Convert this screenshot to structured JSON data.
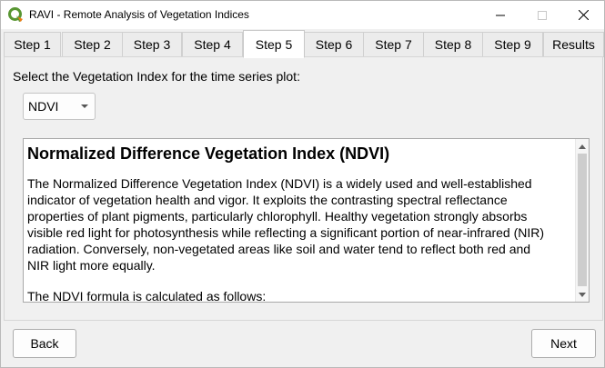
{
  "window": {
    "title": "RAVI - Remote Analysis of Vegetation Indices",
    "icon": "qgis-logo-icon",
    "controls": [
      "minimize-icon",
      "maximize-icon",
      "close-icon"
    ]
  },
  "tabs": [
    {
      "label": "Step 1",
      "active": false
    },
    {
      "label": "Step 2",
      "active": false
    },
    {
      "label": "Step 3",
      "active": false
    },
    {
      "label": "Step 4",
      "active": false
    },
    {
      "label": "Step 5",
      "active": true
    },
    {
      "label": "Step 6",
      "active": false
    },
    {
      "label": "Step 7",
      "active": false
    },
    {
      "label": "Step 8",
      "active": false
    },
    {
      "label": "Step 9",
      "active": false
    },
    {
      "label": "Results",
      "active": false
    }
  ],
  "main": {
    "prompt": "Select the Vegetation Index for the time series plot:",
    "index_select": {
      "value": "NDVI"
    },
    "description": {
      "heading": "Normalized Difference Vegetation Index (NDVI)",
      "lines": [
        "The Normalized Difference Vegetation Index (NDVI) is a widely used and well-established",
        "indicator of vegetation health and vigor. It exploits the contrasting spectral reflectance",
        "properties of plant pigments, particularly chlorophyll. Healthy vegetation strongly absorbs",
        "visible red light for photosynthesis while reflecting a significant portion of near-infrared (NIR)",
        "radiation. Conversely, non-vegetated areas like soil and water tend to reflect both red and",
        "NIR light more equally."
      ],
      "formula_intro": "The NDVI formula is calculated as follows:"
    }
  },
  "buttons": {
    "back": "Back",
    "next": "Next"
  },
  "colors": {
    "qgis_green": "#589632",
    "qgis_yellow": "#ee7913"
  }
}
